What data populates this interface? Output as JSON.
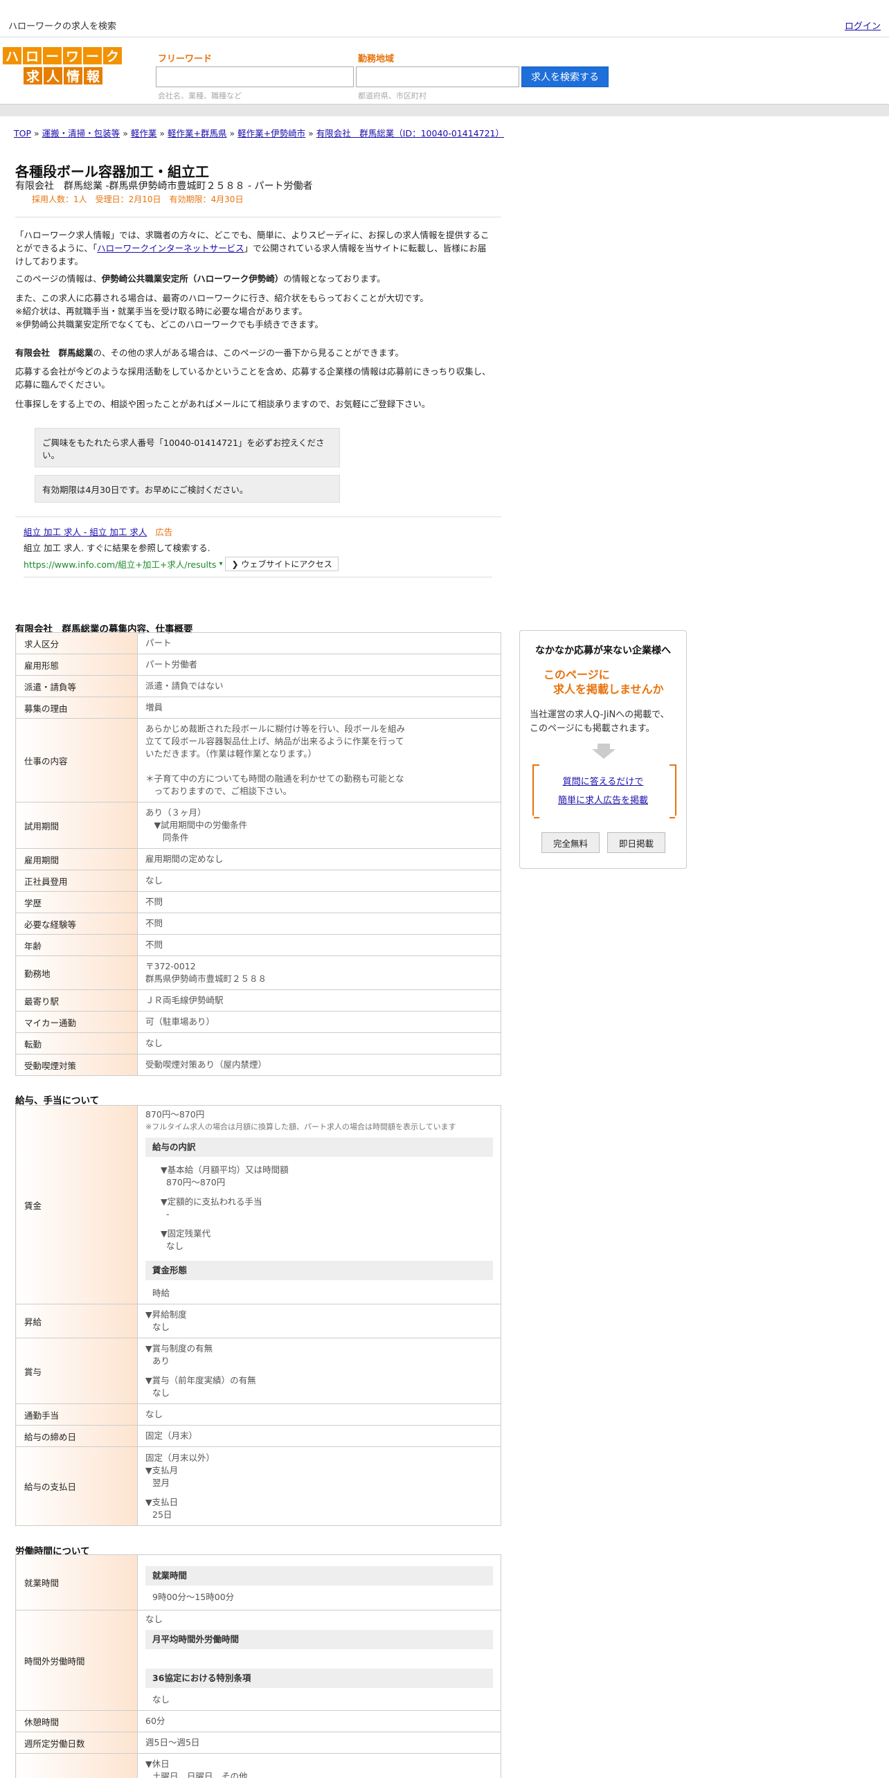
{
  "header": {
    "search_title": "ハローワークの求人を検索",
    "login": "ログイン"
  },
  "logo": {
    "row1": [
      "ハ",
      "ロ",
      "ー",
      "ワ",
      "ー",
      "ク"
    ],
    "row2": [
      "求",
      "人",
      "情",
      "報"
    ]
  },
  "search": {
    "freeword_label": "フリーワード",
    "freeword_placeholder": "会社名、業種、職種など",
    "area_label": "勤務地域",
    "area_placeholder": "都道府県、市区町村",
    "button": "求人を検索する"
  },
  "breadcrumb": [
    "TOP",
    "運搬・清掃・包装等",
    "軽作業",
    "軽作業+群馬県",
    "軽作業+伊勢崎市",
    "有限会社　群馬総業（ID：10040-01414721）"
  ],
  "job": {
    "title": "各種段ボール容器加工・組立工",
    "subtitle": "有限会社　群馬総業 -群馬県伊勢崎市豊城町２５８８ - パート労働者",
    "meta": "採用人数：1人　受理日：2月10日　有効期限：4月30日"
  },
  "intro": {
    "p1a": "「ハローワーク求人情報」では、求職者の方々に、どこでも、簡単に、よりスピーディに、お探しの求人情報を提供することができるように、「",
    "p1link": "ハローワークインターネットサービス",
    "p1b": "」で公開されている求人情報を当サイトに転載し、皆様にお届けしております。",
    "p2a": "このページの情報は、",
    "p2b": "伊勢崎公共職業安定所（ハローワーク伊勢崎）",
    "p2c": "の情報となっております。",
    "p3": [
      "また、この求人に応募される場合は、最寄のハローワークに行き、紹介状をもらっておくことが大切です。",
      "※紹介状は、再就職手当・就業手当を受け取る時に必要な場合があります。",
      "※伊勢崎公共職業安定所でなくても、どこのハローワークでも手続きできます。"
    ],
    "p4a": "有限会社　群馬総業",
    "p4b": "の、その他の求人がある場合は、このページの一番下から見ることができます。",
    "p5": "応募する会社が今どのような採用活動をしているかということを含め、応募する企業様の情報は応募前にきっちり収集し、応募に臨んでください。",
    "p6": "仕事探しをする上での、相談や困ったことがあればメールにて相談承りますので、お気軽にご登録下さい。"
  },
  "notes": {
    "n1": "ご興味をもたれたら求人番号「10040-01414721」を必ずお控えください。",
    "n2": "有効期限は4月30日です。お早めにご検討ください。"
  },
  "ad": {
    "title": "組立 加工 求人 - 組立 加工 求人",
    "tag": "広告",
    "desc": "組立 加工 求人. すぐに結果を参照して検索する.",
    "url": "https://www.info.com/組立+加工+求人/results",
    "url_arrow": "▾",
    "button": "❯ ウェブサイトにアクセス"
  },
  "sections": {
    "overview": "有限会社　群馬総業の募集内容、仕事概要",
    "salary": "給与、手当について",
    "hours": "労働時間について"
  },
  "overview_rows": [
    {
      "k": "求人区分",
      "v": [
        "パート"
      ]
    },
    {
      "k": "雇用形態",
      "v": [
        "パート労働者"
      ]
    },
    {
      "k": "派遣・請負等",
      "v": [
        "派遣・請負ではない"
      ]
    },
    {
      "k": "募集の理由",
      "v": [
        "増員"
      ]
    },
    {
      "k": "仕事の内容",
      "v": [
        "あらかじめ裁断された段ボールに糊付け等を行い、段ボールを組み",
        "立てて段ボール容器製品仕上げ、納品が出来るように作業を行って",
        "いただきます。（作業は軽作業となります。）",
        "",
        "＊子育て中の方についても時間の融通を利かせての勤務も可能とな",
        "　っておりますので、ご相談下さい。"
      ]
    },
    {
      "k": "試用期間",
      "v": [
        "あり（３ヶ月）",
        "　▼試用期間中の労働条件",
        "　　同条件"
      ]
    },
    {
      "k": "雇用期間",
      "v": [
        "雇用期間の定めなし"
      ]
    },
    {
      "k": "正社員登用",
      "v": [
        "なし"
      ]
    },
    {
      "k": "学歴",
      "v": [
        "不問"
      ]
    },
    {
      "k": "必要な経験等",
      "v": [
        "不問"
      ]
    },
    {
      "k": "年齢",
      "v": [
        "不問"
      ]
    },
    {
      "k": "勤務地",
      "v": [
        "〒372-0012",
        "群馬県伊勢崎市豊城町２５８８"
      ]
    },
    {
      "k": "最寄り駅",
      "v": [
        "ＪＲ両毛線伊勢崎駅"
      ]
    },
    {
      "k": "マイカー通勤",
      "v": [
        "可（駐車場あり）"
      ]
    },
    {
      "k": "転勤",
      "v": [
        "なし"
      ]
    },
    {
      "k": "受動喫煙対策",
      "v": [
        "受動喫煙対策あり（屋内禁煙）"
      ]
    }
  ],
  "salary": {
    "wage_label": "賃金",
    "wage_value": "870円〜870円",
    "wage_note": "※フルタイム求人の場合は月額に換算した額、パート求人の場合は時間額を表示しています",
    "breakdown_h": "給与の内訳",
    "base_label": "▼基本給（月額平均）又は時間額",
    "base_value": "870円〜870円",
    "fixed_label": "▼定額的に支払われる手当",
    "fixed_value": "-",
    "overtime_label": "▼固定残業代",
    "overtime_value": "なし",
    "form_h": "賃金形態",
    "form_value": "時給",
    "raise_label": "昇給",
    "raise_v1": "▼昇給制度",
    "raise_v2": "なし",
    "bonus_label": "賞与",
    "bonus_v1": "▼賞与制度の有無",
    "bonus_v2": "あり",
    "bonus_v3": "▼賞与（前年度実績）の有無",
    "bonus_v4": "なし",
    "commute_label": "通勤手当",
    "commute_value": "なし",
    "close_label": "給与の締め日",
    "close_value": "固定（月末）",
    "pay_label": "給与の支払日",
    "pay_v1": "固定（月末以外）",
    "pay_v2": "▼支払月",
    "pay_v3": "翌月",
    "pay_v4": "▼支払日",
    "pay_v5": "25日"
  },
  "hours": {
    "work_label": "就業時間",
    "work_h": "就業時間",
    "work_value": "9時00分〜15時00分",
    "ot_label": "時間外労働時間",
    "ot_value": "なし",
    "ot_h1": "月平均時間外労働時間",
    "ot_h2": "36協定における特別条項",
    "ot_value2": "なし",
    "break_label": "休憩時間",
    "break_value": "60分",
    "days_label": "週所定労働日数",
    "days_value": "週5日〜週5日",
    "hol_v1": "▼休日",
    "hol_v2": "土曜日、日曜日、その他"
  },
  "sidebar": {
    "heading": "なかなか応募が来ない企業様へ",
    "offer1": "このページに",
    "offer2": "求人を掲載しませんか",
    "desc": "当社運営の求人Q-JiNへの掲載で、このページにも掲載されます。",
    "link1": "質問に答えるだけで",
    "link2": "簡単に求人広告を掲載",
    "btn_free": "完全無料",
    "btn_today": "即日掲載"
  }
}
